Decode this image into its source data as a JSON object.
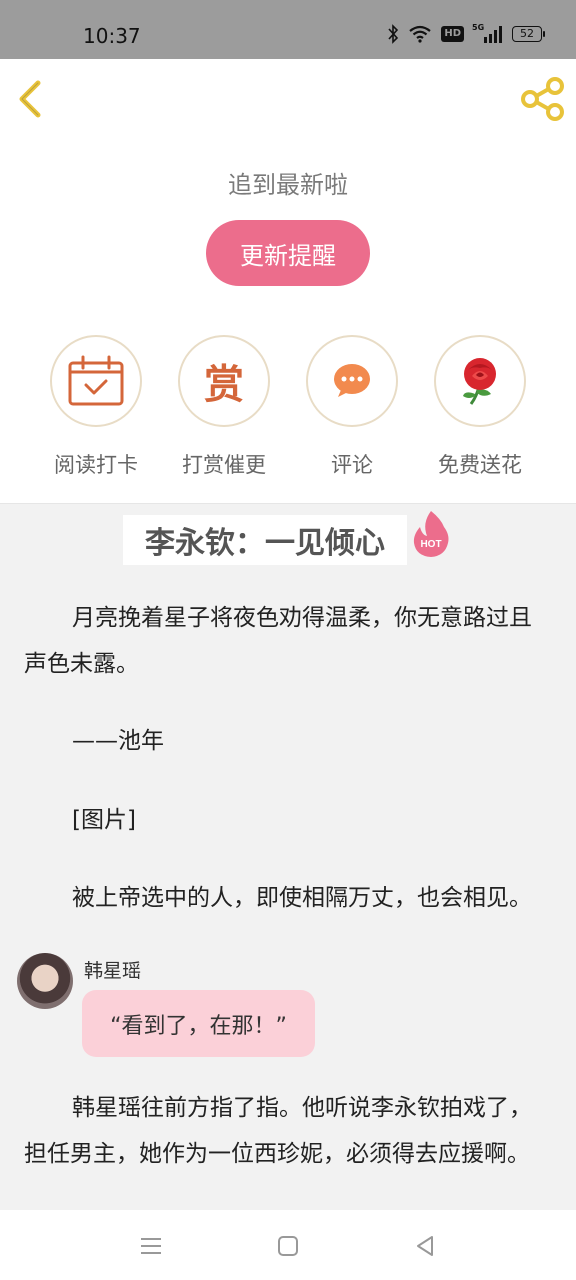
{
  "status_bar": {
    "time": "10:37",
    "hd_label": "HD",
    "network_label": "5G",
    "battery": "52",
    "icons": [
      "bluetooth-icon",
      "wifi-icon",
      "hd-icon",
      "signal-icon",
      "battery-icon"
    ]
  },
  "header": {
    "back_icon": "chevron-left-icon",
    "share_icon": "share-icon",
    "caught_up_text": "追到最新啦",
    "update_button_label": "更新提醒"
  },
  "actions": [
    {
      "label": "阅读打卡",
      "icon": "calendar-check-icon"
    },
    {
      "label": "打赏催更",
      "icon": "reward-icon",
      "glyph": "赏"
    },
    {
      "label": "评论",
      "icon": "comment-icon"
    },
    {
      "label": "免费送花",
      "icon": "rose-icon"
    }
  ],
  "chapter": {
    "title": "李永钦：一见倾心",
    "badge": "HOT"
  },
  "content": {
    "paragraphs": [
      "月亮挽着星子将夜色劝得温柔，你无意路过且声色未露。",
      "——池年",
      "[图片]",
      "被上帝选中的人，即使相隔万丈，也会相见。"
    ],
    "dialogue": {
      "speaker": "韩星瑶",
      "text": "“看到了，在那！”"
    },
    "after_dialogue": "韩星瑶往前方指了指。他听说李永钦拍戏了，担任男主，她作为一位西珍妮，必须得去应援啊。"
  },
  "colors": {
    "accent_pink": "#ec6d8c",
    "bubble_pink": "#fbd0d8",
    "icon_yellow": "#e8c33a",
    "status_gray": "#9c9c9c"
  },
  "nav_bar": [
    "menu-icon",
    "home-icon",
    "back-triangle-icon"
  ]
}
